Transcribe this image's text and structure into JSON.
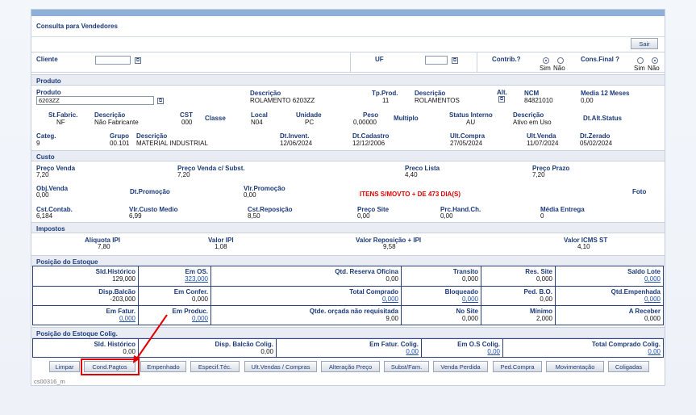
{
  "window": {
    "title": "Consulta para Vendedores",
    "sair": "Sair",
    "screen_code": "cs00316_m"
  },
  "filters": {
    "cliente_label": "Cliente",
    "cliente_value": "",
    "uf_label": "UF",
    "uf_value": "",
    "contrib_label": "Contrib.?",
    "cons_final_label": "Cons.Final ?",
    "sim": "Sim",
    "nao": "Não"
  },
  "produto": {
    "section": "Produto",
    "produto_label": "Produto",
    "produto_value": "6203ZZ",
    "descricao_label": "Descrição",
    "descricao_value": "ROLAMENTO 6203ZZ",
    "tpprod_label": "Tp.Prod.",
    "tpprod_value": "11",
    "descricao2_label": "Descrição",
    "descricao2_value": "ROLAMENTOS",
    "alt_label": "Alt.",
    "ncm_label": "NCM",
    "ncm_value": "84821010",
    "media_label": "Media 12 Meses",
    "media_value": "0,00",
    "stfabric_label": "St.Fabric.",
    "stfabric_value": "NF",
    "descricao3_label": "Descrição",
    "descricao3_value": "Não Fabricante",
    "cst_label": "CST",
    "cst_value": "000",
    "classe_label": "Classe",
    "local_label": "Local",
    "local_value": "N04",
    "unidade_label": "Unidade",
    "unidade_value": "PC",
    "peso_label": "Peso",
    "peso_value": "0,00000",
    "multiplo_label": "Multiplo",
    "status_label": "Status Interno",
    "status_value": "AU",
    "descricao4_label": "Descrição",
    "descricao4_value": "Ativo em Uso",
    "dtaltstatus_label": "Dt.Alt.Status",
    "categ_label": "Categ.",
    "categ_value": "9",
    "grupo_label": "Grupo",
    "grupo_value": "00.101",
    "descricao5_label": "Descrição",
    "descricao5_value": "MATERIAL INDUSTRIAL",
    "dtinvent_label": "Dt.Invent.",
    "dtinvent_value": "12/06/2024",
    "dtcadastro_label": "Dt.Cadastro",
    "dtcadastro_value": "12/12/2006",
    "ultcompra_label": "Ult.Compra",
    "ultcompra_value": "27/05/2024",
    "ultvenda_label": "Ult.Venda",
    "ultvenda_value": "11/07/2024",
    "dtzerado_label": "Dt.Zerado",
    "dtzerado_value": "05/02/2024"
  },
  "custo": {
    "section": "Custo",
    "precovenda_label": "Preço Venda",
    "precovenda_value": "7,20",
    "precovendasubst_label": "Preço Venda c/ Subst.",
    "precovendasubst_value": "7,20",
    "precolista_label": "Preco Lista",
    "precolista_value": "4,40",
    "precoprazo_label": "Preço Prazo",
    "precoprazo_value": "7,20",
    "objvenda_label": "Obj.Venda",
    "objvenda_value": "0,00",
    "dtpromocao_label": "Dt.Promoção",
    "vlrpromocao_label": "Vlr.Promoção",
    "vlrpromocao_value": "0,00",
    "itens_alert": "ITENS S/MOVTO + DE 473 DIA(S)",
    "foto_label": "Foto",
    "cstcontab_label": "Cst.Contab.",
    "cstcontab_value": "6,184",
    "vlrcustomedio_label": "Vlr.Custo Medio",
    "vlrcustomedio_value": "6,99",
    "cstreposicao_label": "Cst.Reposição",
    "cstreposicao_value": "8,50",
    "precosite_label": "Preço Site",
    "precosite_value": "0,00",
    "prchandch_label": "Prc.Hand.Ch.",
    "prchandch_value": "0,00",
    "mediaentrega_label": "Média Entrega",
    "mediaentrega_value": "0"
  },
  "impostos": {
    "section": "Impostos",
    "aliquota_label": "Alíquota IPI",
    "aliquota_value": "7,80",
    "valoripi_label": "Valor IPI",
    "valoripi_value": "1,08",
    "valorrepos_label": "Valor Reposição + IPI",
    "valorrepos_value": "9,58",
    "icms_label": "Valor ICMS ST",
    "icms_value": "4,10"
  },
  "estoque": {
    "section": "Posição do Estoque",
    "rows": [
      [
        {
          "label": "Sld.Histórico",
          "value": "129,000",
          "link": false
        },
        {
          "label": "Em OS.",
          "value": "323,000",
          "link": true
        },
        {
          "label": "Qtd. Reserva Oficina",
          "value": "0,00",
          "link": false
        },
        {
          "label": "Transito",
          "value": "0,000",
          "link": false
        },
        {
          "label": "Res. Site",
          "value": "0,000",
          "link": false
        },
        {
          "label": "Saldo Lote",
          "value": "0,000",
          "link": true
        }
      ],
      [
        {
          "label": "Disp.Balcão",
          "value": "-203,000",
          "link": false
        },
        {
          "label": "Em Confer.",
          "value": "0,000",
          "link": false
        },
        {
          "label": "Total Comprado",
          "value": "0,000",
          "link": true
        },
        {
          "label": "Bloqueado",
          "value": "0,000",
          "link": true
        },
        {
          "label": "Ped. B.O.",
          "value": "0,00",
          "link": false
        },
        {
          "label": "Qtd.Empenhada",
          "value": "0,000",
          "link": true
        }
      ],
      [
        {
          "label": "Em Fatur.",
          "value": "0,000",
          "link": true
        },
        {
          "label": "Em Produc.",
          "value": "0,000",
          "link": true
        },
        {
          "label": "Qtde. orçada não requisitada",
          "value": "9,00",
          "link": false
        },
        {
          "label": "No Site",
          "value": "0,000",
          "link": false
        },
        {
          "label": "Mínimo",
          "value": "2,000",
          "link": false
        },
        {
          "label": "A Receber",
          "value": "0,000",
          "link": false
        }
      ]
    ]
  },
  "coligadas": {
    "section": "Posição do Estoque Colig.",
    "cells": [
      {
        "label": "Sld. Histórico",
        "value": "0,00",
        "link": false
      },
      {
        "label": "Disp. Balcão Colig.",
        "value": "0,00",
        "link": false
      },
      {
        "label": "Em Fatur. Colig.",
        "value": "0,00",
        "link": true
      },
      {
        "label": "Em O.S Colig.",
        "value": "0,00",
        "link": true
      },
      {
        "label": "Total Comprado Colig.",
        "value": "0,00",
        "link": true
      }
    ]
  },
  "buttons": [
    "Limpar",
    "Cond.Pagtos",
    "Empenhado",
    "Especif.Téc.",
    "Ult.Vendas / Compras",
    "Alteração Preço",
    "Subst/Fam.",
    "Venda Perdida",
    "Ped.Compra",
    "Movimentação",
    "Coligadas"
  ],
  "colors": {
    "accent": "#1c3a78",
    "highlight": "#e00000",
    "link": "#1e4fa8"
  }
}
